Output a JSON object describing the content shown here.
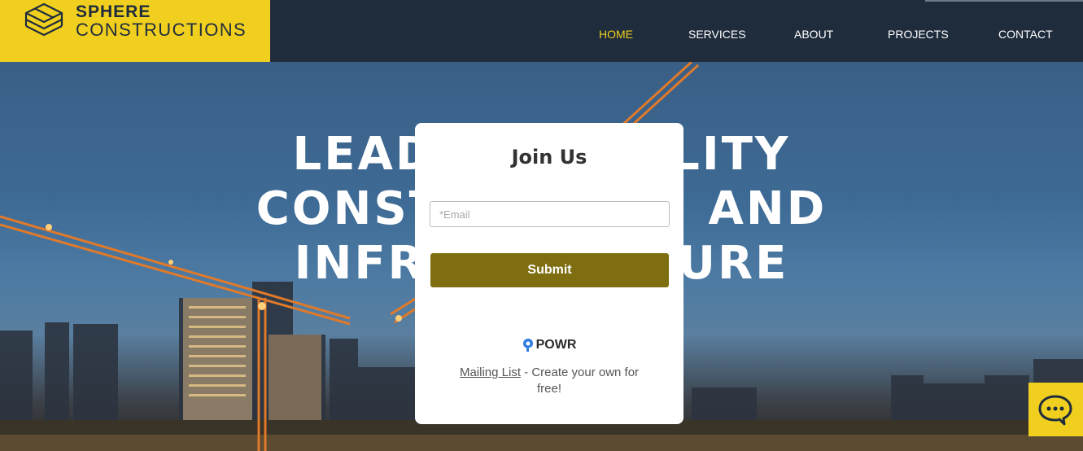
{
  "brand": {
    "line1": "SPHERE",
    "line2": "CONSTRUCTIONS",
    "accent_color": "#f0cf1f",
    "header_color": "#1f2c3c"
  },
  "nav": {
    "items": [
      {
        "label": "HOME",
        "active": true
      },
      {
        "label": "SERVICES",
        "active": false
      },
      {
        "label": "ABOUT",
        "active": false
      },
      {
        "label": "PROJECTS",
        "active": false
      },
      {
        "label": "CONTACT",
        "active": false
      }
    ]
  },
  "hero": {
    "title_lines": [
      "LEADING QUALITY",
      "CONSTRUCTION AND",
      "INFRASTRUCTURE"
    ]
  },
  "popup": {
    "title": "Join Us",
    "email_placeholder": "*Email",
    "email_value": "",
    "submit_label": "Submit",
    "submit_color": "#7f6e10",
    "provider_icon": "powr-logo-icon",
    "provider_name": "POWR",
    "credit_link": "Mailing List",
    "credit_text": " - Create your own for free!"
  },
  "chat": {
    "icon": "chat-bubble-icon"
  }
}
